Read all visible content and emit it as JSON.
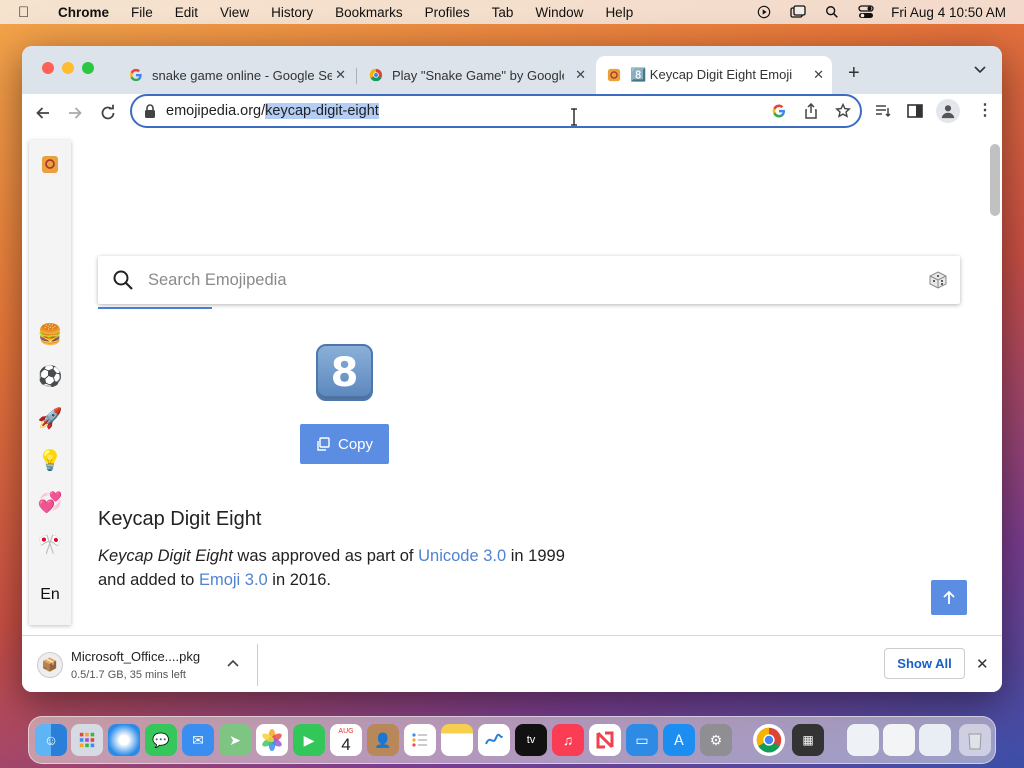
{
  "menubar": {
    "app_name": "Chrome",
    "items": [
      "File",
      "Edit",
      "View",
      "History",
      "Bookmarks",
      "Profiles",
      "Tab",
      "Window",
      "Help"
    ],
    "clock": "Fri Aug 4  10:50 AM"
  },
  "tabs": [
    {
      "title": "snake game online - Google Se",
      "icon": "google-icon"
    },
    {
      "title": "Play \"Snake Game\" by Google",
      "icon": "chrome-icon"
    },
    {
      "title": "8️⃣ Keycap Digit Eight Emoji",
      "icon": "emojipedia-icon"
    }
  ],
  "omnibox": {
    "url_host": "emojipedia.org/",
    "url_path": "keycap-digit-eight"
  },
  "sidebar": {
    "items": [
      "🍔",
      "⚽",
      "🚀",
      "💡",
      "💞",
      "🎌"
    ],
    "language": "En"
  },
  "search": {
    "placeholder": "Search Emojipedia"
  },
  "emoji": {
    "glyph": "8",
    "copy_label": "Copy",
    "heading": "Keycap Digit Eight",
    "desc_name": "Keycap Digit Eight",
    "desc_part1": " was approved as part of ",
    "unicode_link": "Unicode 3.0",
    "desc_part2": " in 1999",
    "desc_part3": "and added to ",
    "emoji_link": "Emoji 3.0",
    "desc_part4": " in 2016."
  },
  "download": {
    "filename": "Microsoft_Office....pkg",
    "status": "0.5/1.7 GB, 35 mins left",
    "show_all": "Show All"
  },
  "dock": {
    "calendar_month": "AUG",
    "calendar_day": "4",
    "apps": [
      "finder-icon",
      "launchpad-icon",
      "safari-icon",
      "messages-icon",
      "mail-icon",
      "maps-icon",
      "photos-icon",
      "facetime-icon",
      "calendar-icon",
      "contacts-icon",
      "reminders-icon",
      "notes-icon",
      "freeform-icon",
      "tv-icon",
      "music-icon",
      "news-icon",
      "keynote-icon",
      "app-store-icon",
      "system-settings-icon",
      "chrome-icon",
      "calculator-icon",
      "downloads-icon",
      "documents-icon",
      "screenshot-icon",
      "trash-icon"
    ]
  }
}
